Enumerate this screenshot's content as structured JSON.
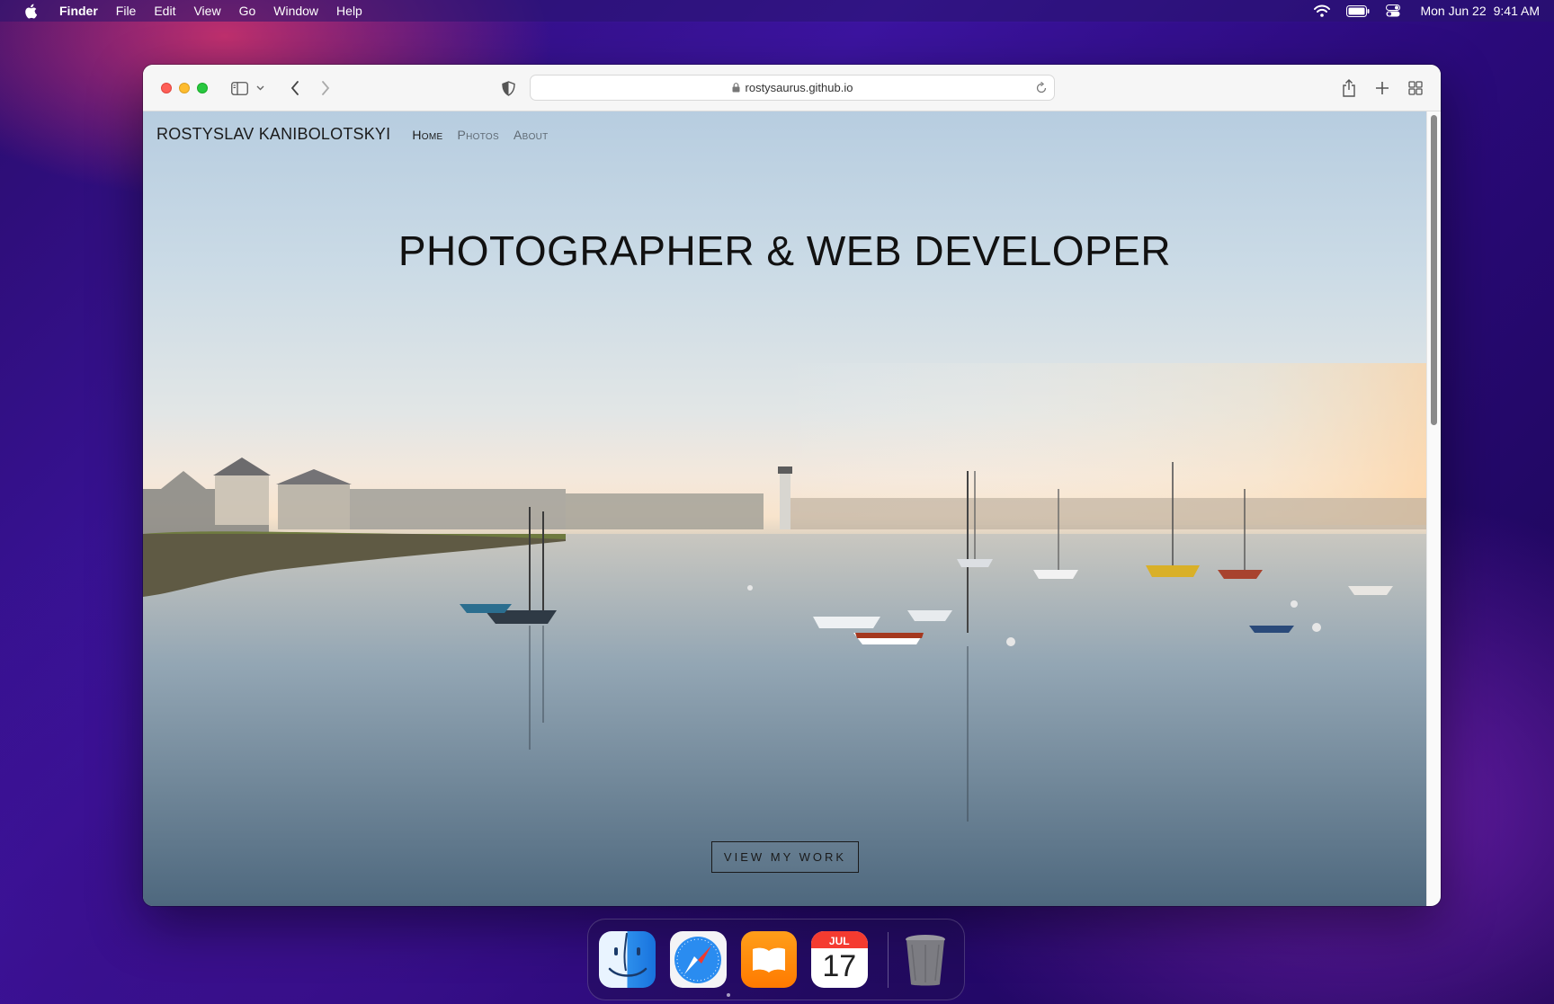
{
  "menubar": {
    "app_name": "Finder",
    "items": [
      "File",
      "Edit",
      "View",
      "Go",
      "Window",
      "Help"
    ],
    "date": "Mon Jun 22",
    "time": "9:41 AM"
  },
  "browser": {
    "url": "rostysaurus.github.io"
  },
  "site": {
    "brand": "ROSTYSLAV KANIBOLOTSKYI",
    "nav": [
      "Home",
      "Photos",
      "About"
    ],
    "hero_title": "PHOTOGRAPHER & WEB DEVELOPER",
    "cta_label": "VIEW MY WORK"
  },
  "dock": {
    "apps": [
      "finder-icon",
      "safari-icon",
      "books-icon",
      "calendar-icon",
      "trash-icon"
    ],
    "calendar_month": "JUL",
    "calendar_day": "17"
  },
  "colors": {
    "traffic_close": "#fe5f57",
    "traffic_min": "#febc2e",
    "traffic_max": "#28c840",
    "books_orange": "#ff8a00",
    "calendar_red": "#f53b30"
  }
}
